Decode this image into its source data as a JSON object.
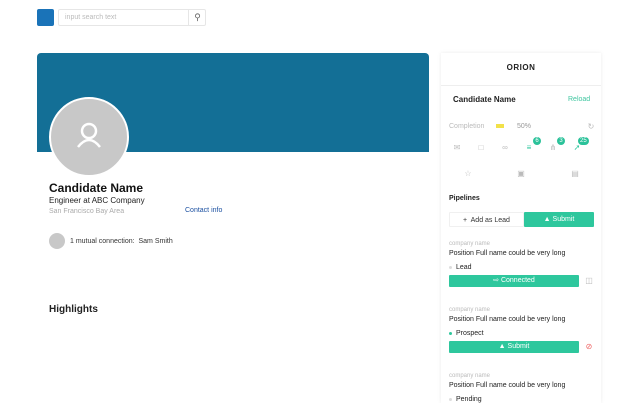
{
  "search": {
    "placeholder": "input search text",
    "icon": "search-icon"
  },
  "profile": {
    "name": "Candidate Name",
    "title": "Engineer at  ABC Company",
    "location": "San Francisco Bay Area",
    "contact_label": "Contact info",
    "mutual_count": "1 mutual connection:",
    "mutual_name": "Sam Smith",
    "highlights": "Highlights"
  },
  "panel": {
    "logo": "ORION",
    "candidate_name": "Candidate Name",
    "reload": "Reload",
    "completion_label": "Completion",
    "completion_pct": "50%",
    "completion_value": 50,
    "badges": [
      "6",
      "3",
      "25"
    ],
    "pipelines_label": "Pipelines",
    "add_lead": "Add as Lead",
    "submit": "Submit",
    "pipelines": [
      {
        "company": "company name",
        "position": "Position Full name could be very long",
        "stage": "Lead",
        "action": "Connected",
        "stage_color": "#dddddd",
        "action_icon": "trash-icon"
      },
      {
        "company": "company name",
        "position": "Position Full name could be very long",
        "stage": "Prospect",
        "action": "Submit",
        "stage_color": "#2ec79d",
        "action_icon": "unlink-icon"
      },
      {
        "company": "company name",
        "position": "Position Full name could be very long",
        "stage": "Pending",
        "stage_color": "#dddddd"
      }
    ]
  },
  "colors": {
    "brand": "#136f96",
    "accent": "#2ec79d"
  }
}
